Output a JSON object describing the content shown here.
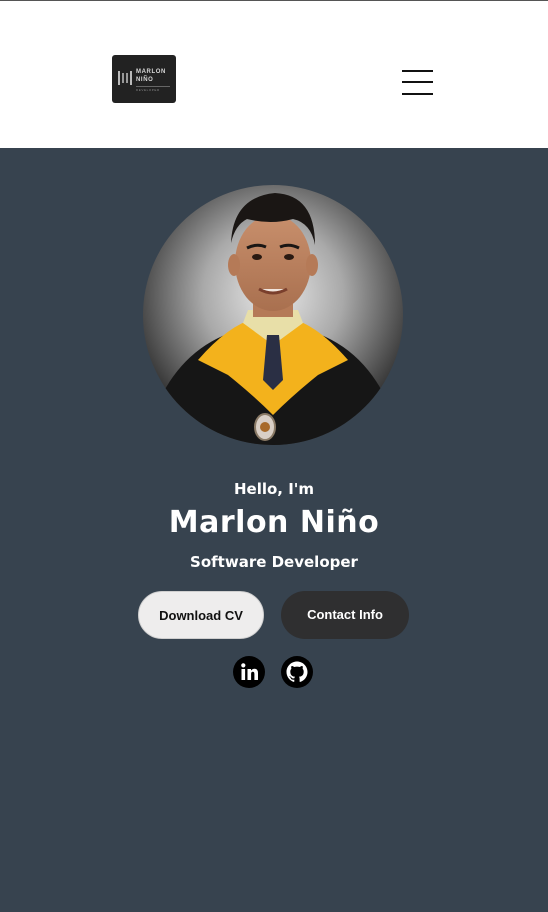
{
  "header": {
    "logo": {
      "line1": "MARLON",
      "line2": "NIÑO",
      "line3": "DEVELOPER"
    },
    "menu_icon": "hamburger-menu-icon"
  },
  "profile": {
    "photo": "graduation-portrait",
    "greeting": "Hello, I'm",
    "name": "Marlon Niño",
    "role": "Software Developer"
  },
  "actions": {
    "download_cv_label": "Download CV",
    "contact_info_label": "Contact Info"
  },
  "social": [
    {
      "icon": "linkedin-icon"
    },
    {
      "icon": "github-icon"
    }
  ],
  "colors": {
    "background": "#37434f",
    "header": "#ffffff",
    "primary_button": "#eeeded",
    "secondary_button": "#2f2f30"
  }
}
